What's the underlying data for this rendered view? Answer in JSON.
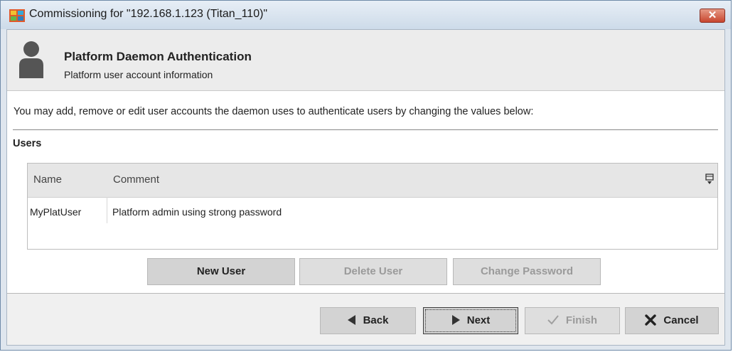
{
  "window": {
    "title": "Commissioning for \"192.168.1.123 (Titan_110)\"",
    "close_label": "✕"
  },
  "header": {
    "title": "Platform Daemon Authentication",
    "subtitle": "Platform user account information"
  },
  "description": "You may add, remove or edit user accounts the daemon uses to authenticate users by changing the values below:",
  "users_section": {
    "label": "Users",
    "columns": [
      "Name",
      "Comment"
    ],
    "rows": [
      {
        "name": "MyPlatUser",
        "comment": "Platform admin using strong password"
      }
    ]
  },
  "user_buttons": {
    "new_user": "New User",
    "delete_user": "Delete User",
    "change_password": "Change Password"
  },
  "nav_buttons": {
    "back": "Back",
    "next": "Next",
    "finish": "Finish",
    "cancel": "Cancel"
  },
  "colors": {
    "accent_close": "#c8462f",
    "button_face": "#d3d3d3",
    "disabled_text": "#9a9a9a"
  },
  "icons": [
    "app-icon",
    "user-icon",
    "column-chooser-icon",
    "back-arrow-icon",
    "next-arrow-icon",
    "check-icon",
    "x-icon"
  ]
}
